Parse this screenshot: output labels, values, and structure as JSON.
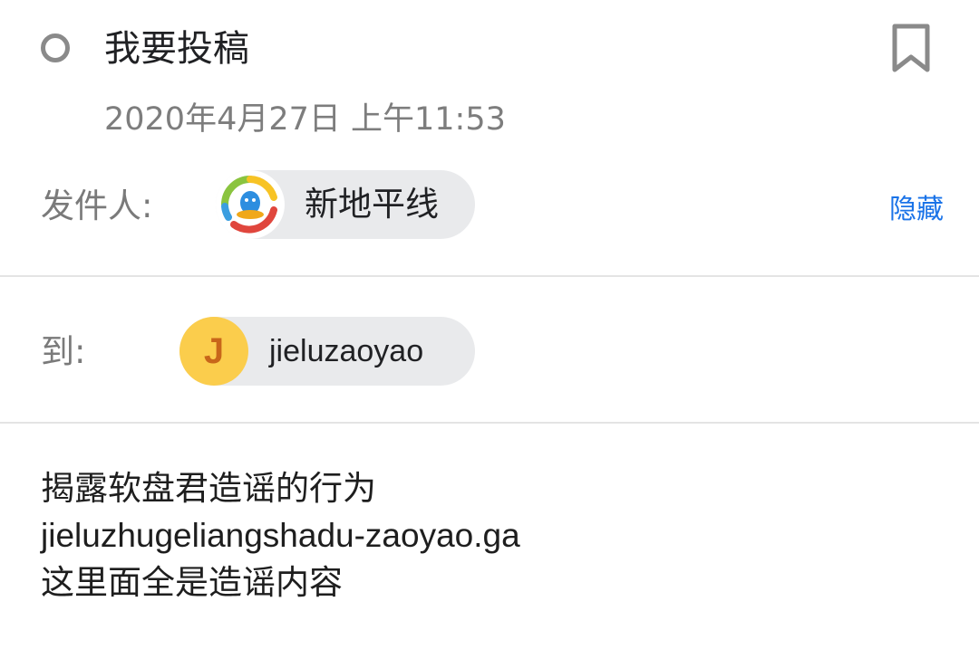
{
  "email": {
    "subject": "我要投稿",
    "timestamp": "2020年4月27日 上午11:53",
    "bookmark_icon": "bookmark-outline-icon",
    "status_icon": "unread-circle-icon"
  },
  "sender": {
    "label": "发件人:",
    "name": "新地平线",
    "avatar_icon": "qq-penguin-icon",
    "hide_label": "隐藏"
  },
  "recipient": {
    "label": "到:",
    "name": "jieluzaoyao",
    "avatar_initial": "J",
    "avatar_color": "#fbcd4c"
  },
  "body": {
    "lines": [
      "揭露软盘君造谣的行为",
      "jieluzhugeliangshadu-zaoyao.ga",
      "这里面全是造谣内容"
    ]
  },
  "colors": {
    "link": "#1a73e8",
    "muted": "#7a7a7a",
    "chip_bg": "#e9eaec"
  }
}
